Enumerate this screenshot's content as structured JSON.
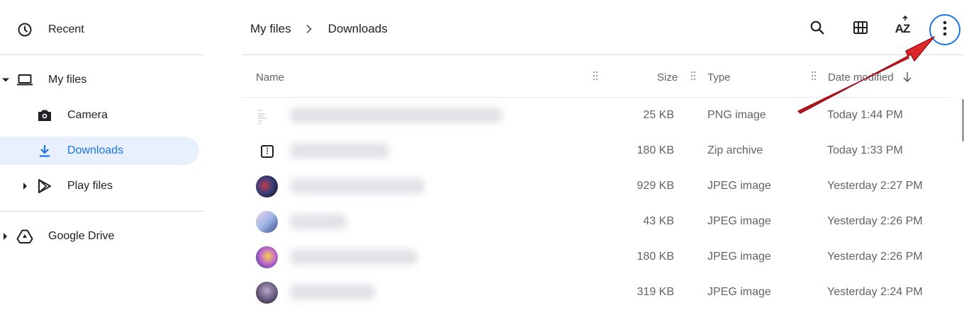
{
  "sidebar": {
    "recent": "Recent",
    "my_files": "My files",
    "camera": "Camera",
    "downloads": "Downloads",
    "play_files": "Play files",
    "google_drive": "Google Drive"
  },
  "breadcrumb": {
    "root": "My files",
    "current": "Downloads"
  },
  "toolbar": {
    "search_icon": "search-icon",
    "grid_icon": "grid-view-icon",
    "sort_icon": "sort-az-icon",
    "sort_label": "AZ",
    "more_icon": "more-vert-icon"
  },
  "columns": {
    "name": "Name",
    "size": "Size",
    "type": "Type",
    "date": "Date modified"
  },
  "files": [
    {
      "size": "25 KB",
      "type": "PNG image",
      "date": "Today 1:44 PM"
    },
    {
      "size": "180 KB",
      "type": "Zip archive",
      "date": "Today 1:33 PM"
    },
    {
      "size": "929 KB",
      "type": "JPEG image",
      "date": "Yesterday 2:27 PM"
    },
    {
      "size": "43 KB",
      "type": "JPEG image",
      "date": "Yesterday 2:26 PM"
    },
    {
      "size": "180 KB",
      "type": "JPEG image",
      "date": "Yesterday 2:26 PM"
    },
    {
      "size": "319 KB",
      "type": "JPEG image",
      "date": "Yesterday 2:24 PM"
    }
  ],
  "colors": {
    "accent": "#1a73e8",
    "selected_bg": "#e8f0fe",
    "annotation_arrow": "#d7191c"
  }
}
